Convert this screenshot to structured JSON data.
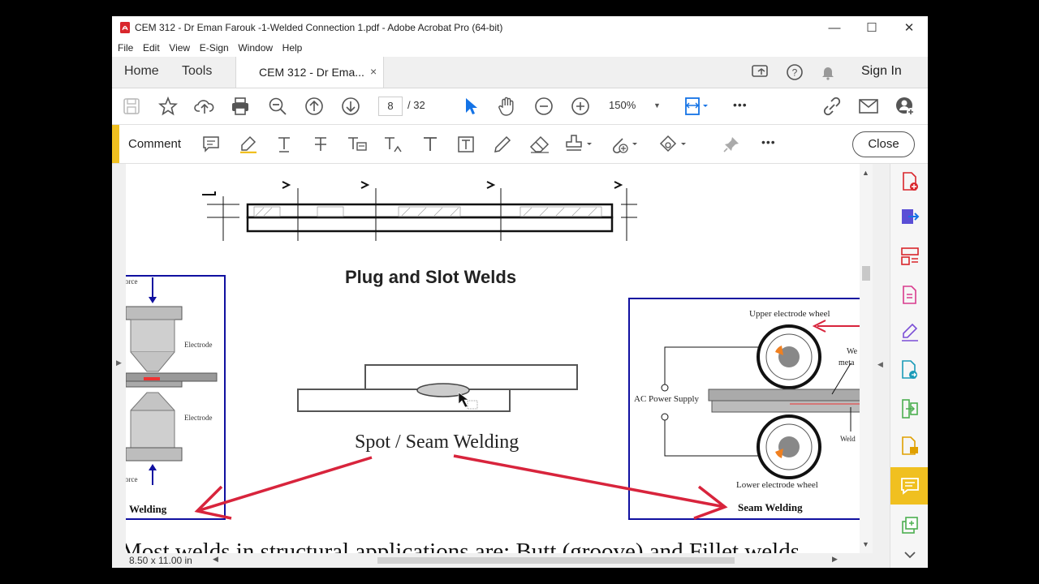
{
  "window": {
    "title": "CEM 312 - Dr Eman Farouk -1-Welded Connection 1.pdf - Adobe Acrobat Pro (64-bit)",
    "minimize": "—",
    "maximize": "☐",
    "close": "✕"
  },
  "menu": [
    "File",
    "Edit",
    "View",
    "E-Sign",
    "Window",
    "Help"
  ],
  "tabs": {
    "home": "Home",
    "tools": "Tools",
    "doc": "CEM 312 - Dr Ema...",
    "doc_close": "×"
  },
  "header": {
    "sign_in": "Sign In"
  },
  "toolbar": {
    "page_current": "8",
    "page_total": "/  32",
    "zoom": "150%",
    "more": "•••"
  },
  "comment_toolbar": {
    "label": "Comment",
    "more": "•••",
    "close": "Close"
  },
  "document": {
    "heading1": "Plug and Slot Welds",
    "heading2": "Spot / Seam Welding",
    "left_figure": {
      "force_top": "Force",
      "electrode_top": "Electrode",
      "electrode_bottom": "Electrode",
      "force_bottom": "Force",
      "caption": "Welding"
    },
    "right_figure": {
      "upper_wheel": "Upper electrode wheel",
      "power": "AC Power Supply",
      "weld_metal_1": "We",
      "weld_metal_2": "meta",
      "weld_label": "Weld",
      "lower_wheel": "Lower electrode wheel",
      "caption": "Seam Welding"
    },
    "bottom_text": "Most welds in structural applications are: Butt (groove) and Fillet welds"
  },
  "status": {
    "page_size": "8.50 x 11.00 in"
  },
  "colors": {
    "accent_yellow": "#f0c020",
    "arrow_red": "#d8243c",
    "figure_blue": "#1010a0",
    "pdf_red": "#d9262c"
  },
  "icons": {
    "toolbar": [
      "save-icon",
      "star-icon",
      "cloud-upload-icon",
      "print-icon",
      "zoom-search-icon",
      "page-up-icon",
      "page-down-icon",
      "select-cursor-icon",
      "hand-icon",
      "zoom-out-icon",
      "zoom-in-icon",
      "fit-page-icon",
      "link-icon",
      "email-icon",
      "add-user-icon"
    ],
    "comment": [
      "sticky-note-icon",
      "highlight-icon",
      "underline-text-icon",
      "strikethrough-icon",
      "replace-text-icon",
      "insert-text-icon",
      "add-text-icon",
      "text-box-icon",
      "pencil-icon",
      "eraser-icon",
      "stamp-icon",
      "attach-icon",
      "shapes-icon",
      "pin-icon"
    ],
    "right_panel": [
      "create-pdf-icon",
      "export-pdf-icon",
      "organize-pages-icon",
      "edit-pdf-icon",
      "fill-sign-icon",
      "export-icon",
      "compress-icon",
      "request-signature-icon",
      "comment-icon",
      "protect-icon",
      "expand-icon"
    ]
  }
}
